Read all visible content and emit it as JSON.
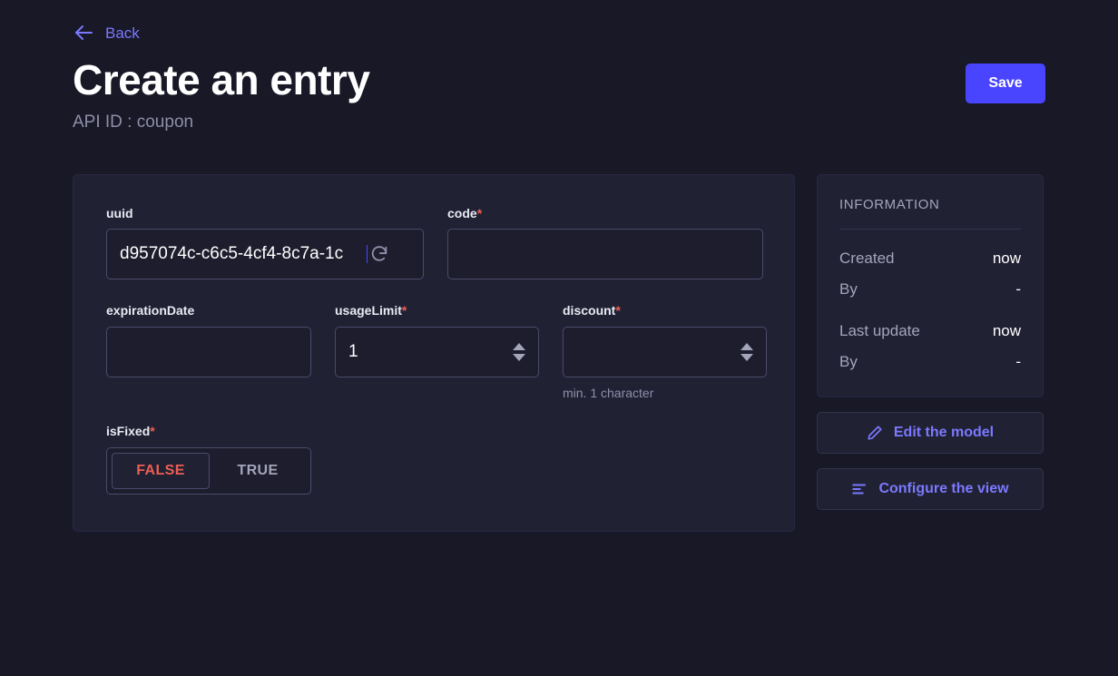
{
  "header": {
    "back_label": "Back",
    "back_icon": "arrow-left-icon",
    "title": "Create an entry",
    "api_id": "API ID : coupon",
    "save_label": "Save"
  },
  "form": {
    "fields": {
      "uuid": {
        "label": "uuid",
        "required": false,
        "value": "d957074c-c6c5-4cf4-8c7a-1c",
        "action_icon": "refresh-icon"
      },
      "code": {
        "label": "code",
        "required": true,
        "required_mark": "*",
        "value": ""
      },
      "expirationDate": {
        "label": "expirationDate",
        "required": false,
        "value": ""
      },
      "usageLimit": {
        "label": "usageLimit",
        "required": true,
        "required_mark": "*",
        "value": "1",
        "stepper": true
      },
      "discount": {
        "label": "discount",
        "required": true,
        "required_mark": "*",
        "value": "",
        "stepper": true,
        "hint": "min. 1 character"
      },
      "isFixed": {
        "label": "isFixed",
        "required": true,
        "required_mark": "*",
        "options": [
          "FALSE",
          "TRUE"
        ],
        "selected": "FALSE"
      }
    }
  },
  "information": {
    "title": "INFORMATION",
    "rows": [
      {
        "key": "Created",
        "value": "now"
      },
      {
        "key": "By",
        "value": "-"
      },
      {
        "key": "Last update",
        "value": "now"
      },
      {
        "key": "By",
        "value": "-"
      }
    ]
  },
  "side_actions": [
    {
      "label": "Edit the model",
      "icon": "pencil-icon"
    },
    {
      "label": "Configure the view",
      "icon": "layout-lines-icon"
    }
  ],
  "colors": {
    "page_background": "#181826",
    "card_background": "#212134",
    "input_background": "#1d1d2e",
    "accent_primary": "#4945ff",
    "accent_link": "#7b79ff",
    "required_red": "#ee5e52",
    "text_primary": "#ffffff",
    "text_muted": "#a5a5ba"
  }
}
